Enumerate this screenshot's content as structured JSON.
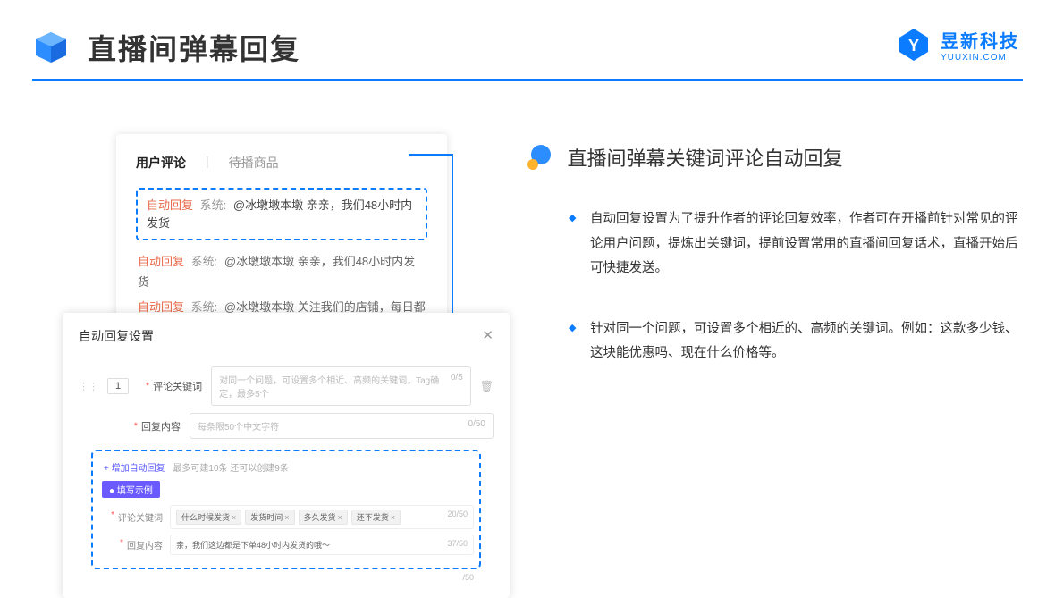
{
  "header": {
    "title": "直播间弹幕回复"
  },
  "brand": {
    "cn": "昱新科技",
    "en": "YUUXIN.COM"
  },
  "card1": {
    "tab1": "用户评论",
    "tab2": "待播商品",
    "hl_tag": "自动回复",
    "hl_gray": "系统:",
    "hl_text": "@冰墩墩本墩 亲亲，我们48小时内发货",
    "r2_tag": "自动回复",
    "r2_gray": "系统:",
    "r2_text": "@冰墩墩本墩 亲亲，我们48小时内发货",
    "r3_tag": "自动回复",
    "r3_gray": "系统:",
    "r3_text": "@冰墩墩本墩 关注我们的店铺，每日都有热门推荐呦～"
  },
  "card2": {
    "title": "自动回复设置",
    "idx": "1",
    "lbl1": "评论关键词",
    "ph1": "对同一个问题，可设置多个相近、高频的关键词，Tag确定，最多5个",
    "cnt1": "0/5",
    "lbl2": "回复内容",
    "ph2": "每条限50个中文字符",
    "cnt2": "0/50",
    "add": "+ 增加自动回复",
    "addhint": "最多可建10条 还可以创建9条",
    "badge": "● 填写示例",
    "mlbl1": "评论关键词",
    "chip1": "什么时候发货",
    "chip2": "发货时间",
    "chip3": "多久发货",
    "chip4": "还不发货",
    "mcnt1": "20/50",
    "mlbl2": "回复内容",
    "mtext": "亲，我们这边都是下单48小时内发货的哦～",
    "mcnt2": "37/50",
    "outer_cnt": "/50"
  },
  "section": {
    "title": "直播间弹幕关键词评论自动回复"
  },
  "bullets": {
    "b1": "自动回复设置为了提升作者的评论回复效率，作者可在开播前针对常见的评论用户问题，提炼出关键词，提前设置常用的直播间回复话术，直播开始后可快捷发送。",
    "b2": "针对同一个问题，可设置多个相近的、高频的关键词。例如：这款多少钱、这块能优惠吗、现在什么价格等。"
  }
}
